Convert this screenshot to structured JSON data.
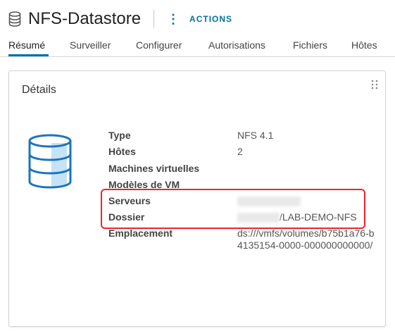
{
  "header": {
    "title": "NFS-Datastore",
    "actions_label": "ACTIONS",
    "icons": {
      "datastore": "datastore-icon",
      "more": "more-vertical-icon"
    }
  },
  "tabs": [
    {
      "label": "Résumé",
      "active": true
    },
    {
      "label": "Surveiller"
    },
    {
      "label": "Configurer"
    },
    {
      "label": "Autorisations"
    },
    {
      "label": "Fichiers"
    },
    {
      "label": "Hôtes"
    }
  ],
  "details": {
    "title": "Détails",
    "rows": [
      {
        "key": "Type",
        "value": "NFS 4.1"
      },
      {
        "key": "Hôtes",
        "value": "2"
      },
      {
        "key": "Machines virtuelles",
        "value": ""
      },
      {
        "key": "Modèles de VM",
        "value": ""
      },
      {
        "key": "Serveurs",
        "value": ""
      },
      {
        "key": "Dossier",
        "value": "/LAB-DEMO-NFS"
      },
      {
        "key": "Emplacement",
        "value": "ds:///vmfs/volumes/b75b1a76-b4135154-0000-000000000000/"
      }
    ]
  },
  "colors": {
    "accent": "#0072a3",
    "highlight": "#e8262a",
    "icon": "#1b75bb",
    "icon_fill": "#c5e3f6"
  }
}
